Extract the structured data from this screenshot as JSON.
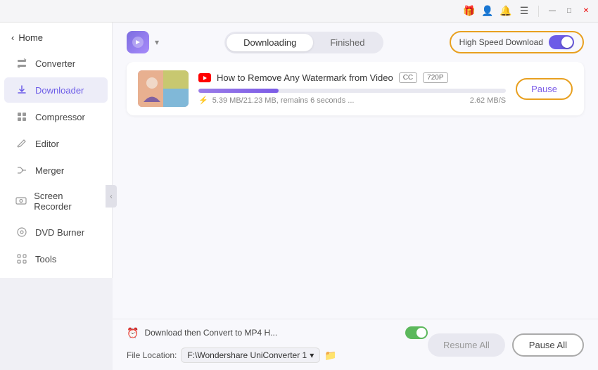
{
  "titlebar": {
    "icons": [
      "gift-icon",
      "user-icon",
      "bell-icon",
      "menu-icon",
      "minimize-icon",
      "maximize-icon",
      "close-icon"
    ]
  },
  "sidebar": {
    "back_label": "Home",
    "items": [
      {
        "id": "converter",
        "label": "Converter",
        "active": false
      },
      {
        "id": "downloader",
        "label": "Downloader",
        "active": true
      },
      {
        "id": "compressor",
        "label": "Compressor",
        "active": false
      },
      {
        "id": "editor",
        "label": "Editor",
        "active": false
      },
      {
        "id": "merger",
        "label": "Merger",
        "active": false
      },
      {
        "id": "screen-recorder",
        "label": "Screen Recorder",
        "active": false
      },
      {
        "id": "dvd-burner",
        "label": "DVD Burner",
        "active": false
      },
      {
        "id": "tools",
        "label": "Tools",
        "active": false
      }
    ]
  },
  "topbar": {
    "tabs": [
      {
        "id": "downloading",
        "label": "Downloading",
        "active": true
      },
      {
        "id": "finished",
        "label": "Finished",
        "active": false
      }
    ],
    "high_speed_label": "High Speed Download",
    "high_speed_on": true
  },
  "download_items": [
    {
      "title": "How to Remove Any Watermark from Video",
      "badge_cc": "CC",
      "badge_quality": "720P",
      "progress_percent": 26,
      "status_text": "5.39 MB/21.23 MB, remains 6 seconds ...",
      "speed_text": "2.62 MB/S",
      "pause_label": "Pause"
    }
  ],
  "bottom": {
    "convert_label": "Download then Convert to MP4 H...",
    "convert_on": true,
    "file_location_label": "File Location:",
    "file_path": "F:\\Wondershare UniConverter 1",
    "resume_all_label": "Resume All",
    "pause_all_label": "Pause All"
  }
}
